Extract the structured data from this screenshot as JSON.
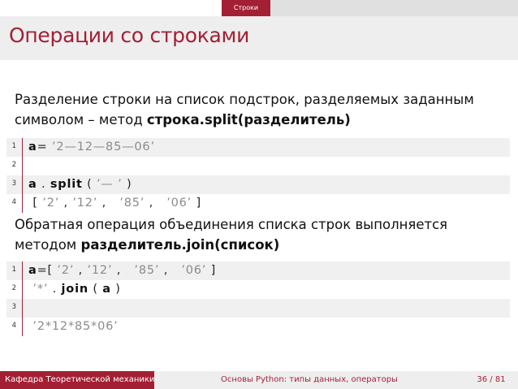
{
  "header": {
    "section_tab": "Строки"
  },
  "slide": {
    "title": "Операции со строками",
    "para1": {
      "text": "Разделение строки на список подстрок, разделяемых заданным символом – метод ",
      "bold": "строка.split(разделитель)"
    },
    "code1": [
      {
        "num": "1",
        "parts": [
          [
            "kw",
            "a"
          ],
          [
            "",
            "= "
          ],
          [
            "str",
            "’2—12—85—06’"
          ]
        ]
      },
      {
        "num": "2",
        "parts": []
      },
      {
        "num": "3",
        "parts": [
          [
            "kw",
            "a"
          ],
          [
            "",
            " . "
          ],
          [
            "kw",
            "split"
          ],
          [
            "",
            " ( "
          ],
          [
            "str",
            "’— ’"
          ],
          [
            "",
            " )"
          ]
        ]
      },
      {
        "num": "4",
        "parts": [
          [
            "",
            " [ "
          ],
          [
            "str",
            "’2’"
          ],
          [
            "",
            " , "
          ],
          [
            "str",
            "’12’"
          ],
          [
            "",
            " ,   "
          ],
          [
            "str",
            "’85’"
          ],
          [
            "",
            " ,   "
          ],
          [
            "str",
            "’06’"
          ],
          [
            "",
            " ]"
          ]
        ]
      }
    ],
    "para2": {
      "text": "Обратная операция объединения списка строк выполняется методом ",
      "bold": "разделитель.join(список)"
    },
    "code2": [
      {
        "num": "1",
        "parts": [
          [
            "kw",
            "a"
          ],
          [
            "",
            "=[ "
          ],
          [
            "str",
            "’2’"
          ],
          [
            "",
            " , "
          ],
          [
            "str",
            "’12’"
          ],
          [
            "",
            " ,   "
          ],
          [
            "str",
            "’85’"
          ],
          [
            "",
            " ,   "
          ],
          [
            "str",
            "’06’"
          ],
          [
            "",
            " ]"
          ]
        ]
      },
      {
        "num": "2",
        "parts": [
          [
            "",
            " "
          ],
          [
            "str",
            "’*’"
          ],
          [
            "",
            " . "
          ],
          [
            "kw",
            "join"
          ],
          [
            "",
            " ( "
          ],
          [
            "kw",
            "a"
          ],
          [
            "",
            " )"
          ]
        ]
      },
      {
        "num": "3",
        "parts": []
      },
      {
        "num": "4",
        "parts": [
          [
            "",
            " "
          ],
          [
            "str",
            "’2*12*85*06’"
          ]
        ]
      }
    ]
  },
  "footer": {
    "department": "Кафедра Теоретической механики",
    "course": "Основы Python: типы данных, операторы",
    "page": "36 / 81"
  },
  "colors": {
    "accent": "#a31f34",
    "code_background": "#f0f0f0",
    "string_literal": "#8a8a8a"
  }
}
